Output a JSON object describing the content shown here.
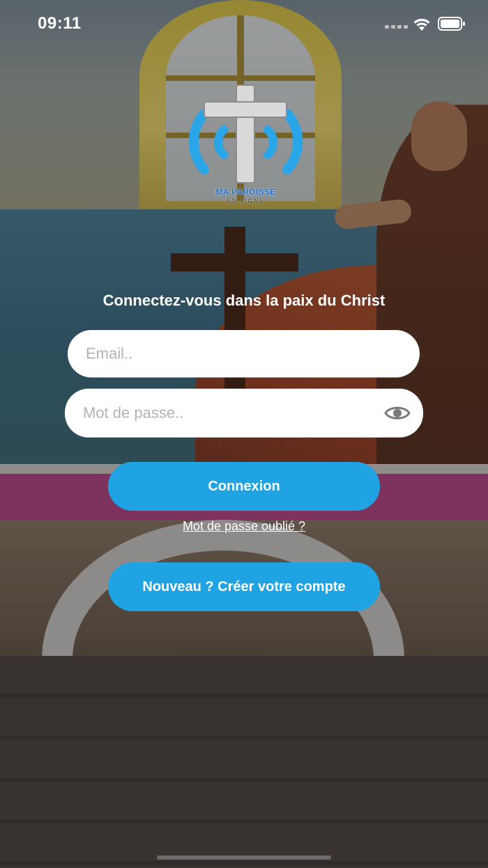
{
  "status_bar": {
    "time": "09:11",
    "signal_icon": "signal-icon",
    "wifi_icon": "wifi-icon",
    "battery_icon": "battery-icon"
  },
  "logo": {
    "title": "MA PAROISSE",
    "subtitle": "EN LIGNE",
    "icon": "cross-broadcast-icon"
  },
  "login": {
    "tagline": "Connectez-vous dans la paix du Christ",
    "email_placeholder": "Email..",
    "email_value": "",
    "password_placeholder": "Mot de passe..",
    "password_value": "",
    "toggle_password_icon": "eye-icon",
    "login_label": "Connexion",
    "forgot_password_label": "Mot de passe oublié ?",
    "signup_label": "Nouveau ? Créer votre compte"
  },
  "colors": {
    "accent": "#1fa3e3",
    "logo_blue": "#2aa6e8",
    "logo_text": "#1f6fd0"
  }
}
